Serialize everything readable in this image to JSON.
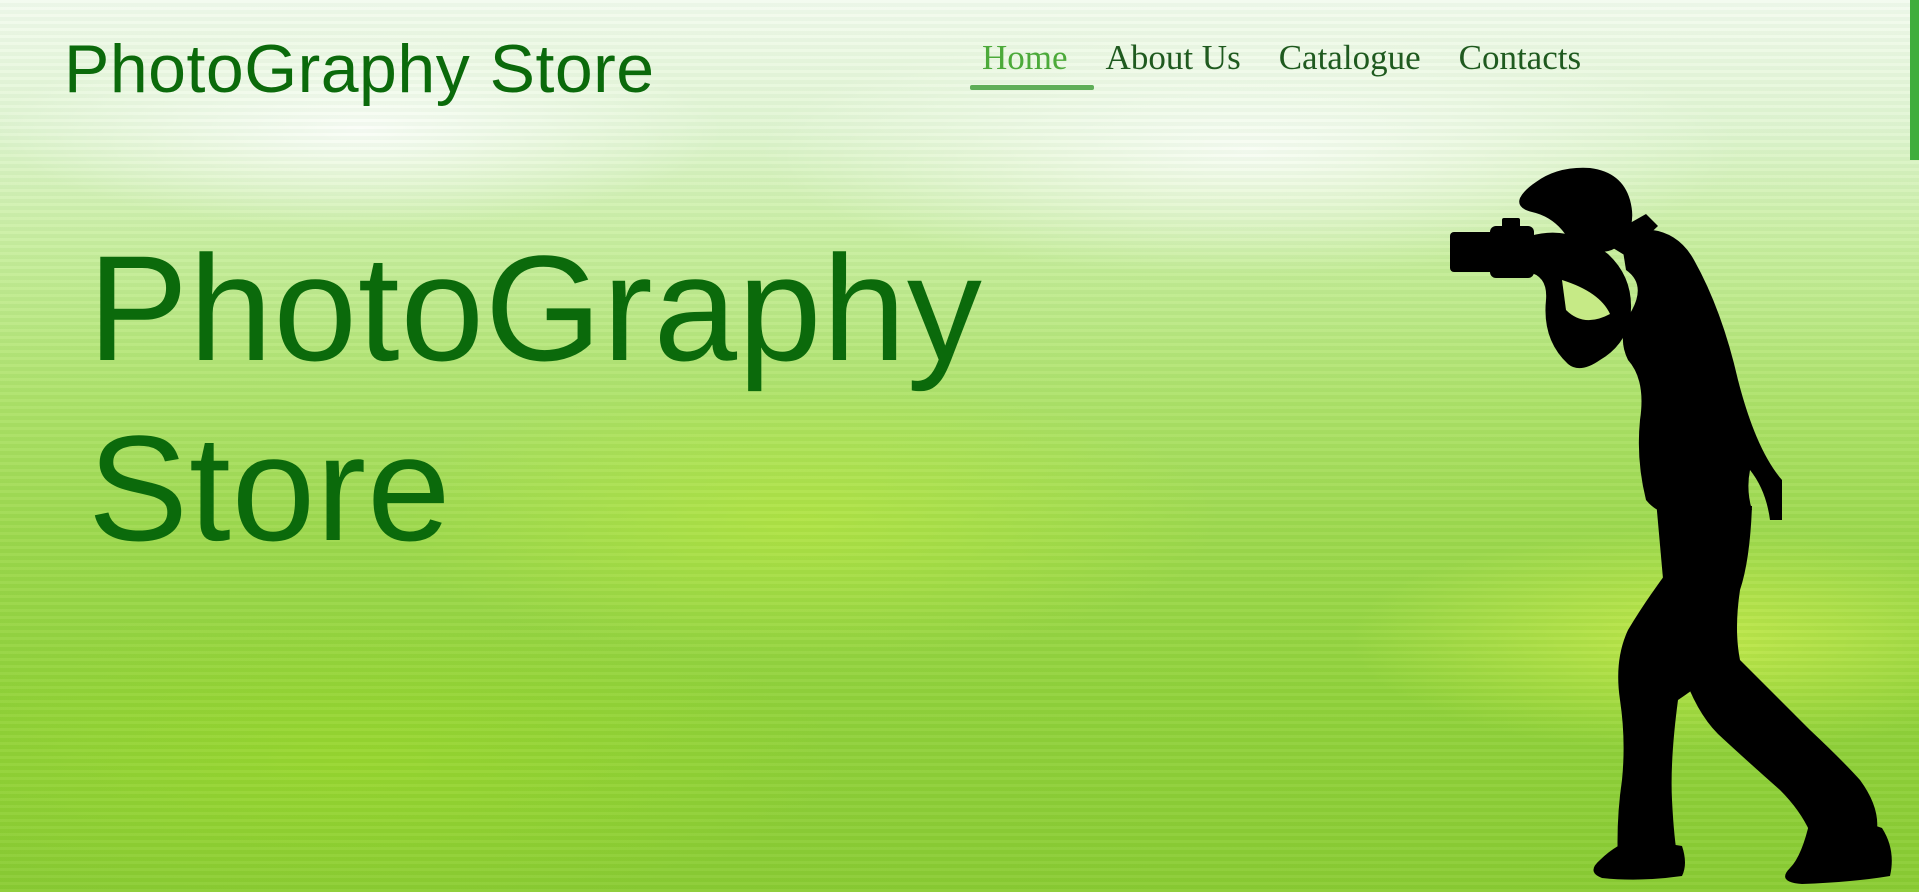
{
  "header": {
    "brand": "PhotoGraphy Store"
  },
  "nav": {
    "items": [
      {
        "label": "Home",
        "active": true
      },
      {
        "label": "About Us",
        "active": false
      },
      {
        "label": "Catalogue",
        "active": false
      },
      {
        "label": "Contacts",
        "active": false
      }
    ]
  },
  "hero": {
    "title_line1": "PhotoGraphy",
    "title_line2": "Store",
    "image": "photographer-silhouette-icon"
  },
  "colors": {
    "brand_green": "#0b6a0b",
    "nav_active": "#4caa3a",
    "nav_underline": "#5fae58",
    "accent_bar": "#3fae3c"
  }
}
